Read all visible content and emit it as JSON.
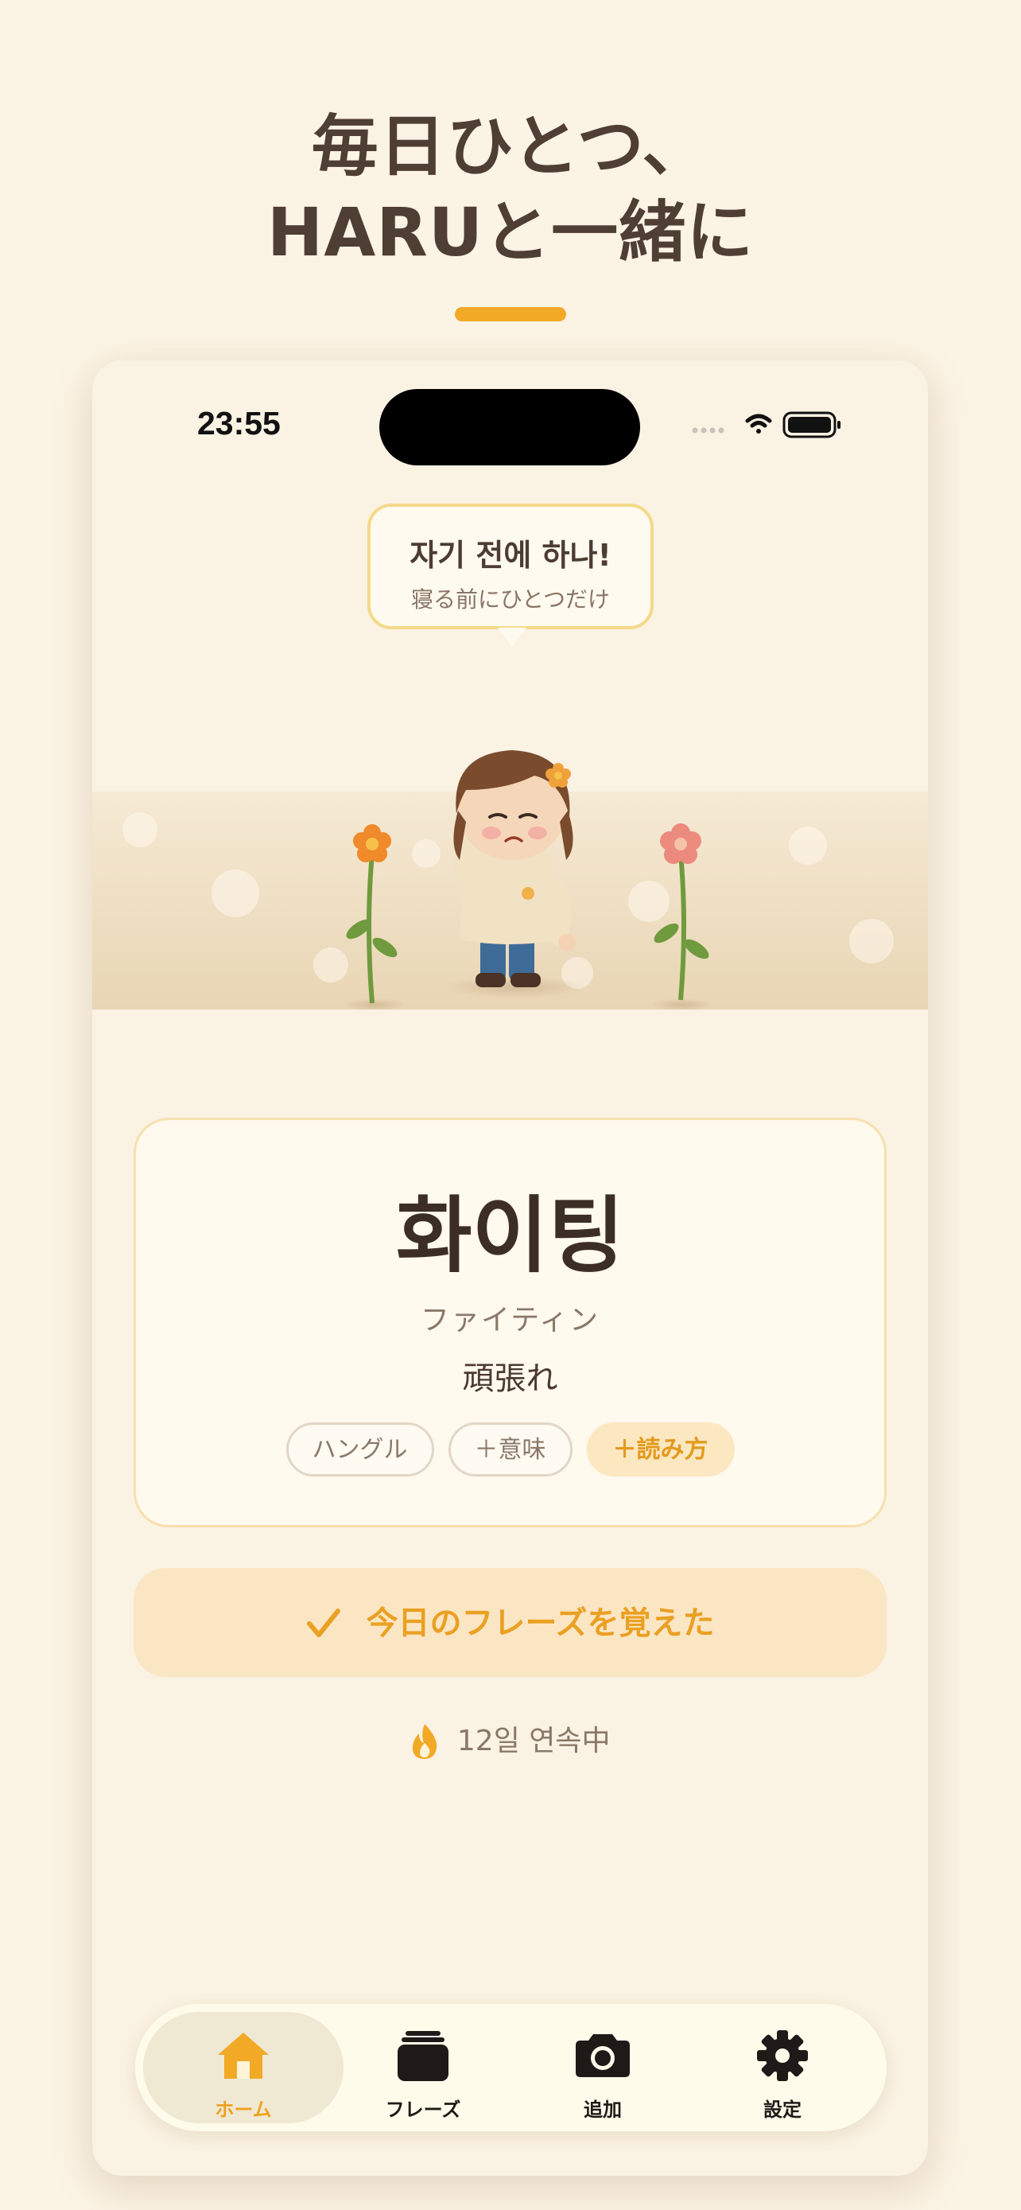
{
  "headline": {
    "line1": "毎日ひとつ、",
    "line2": "HARUと一緒に"
  },
  "status_bar": {
    "time": "23:55"
  },
  "speech_bubble": {
    "korean": "자기 전에 하나!",
    "japanese": "寝る前にひとつだけ"
  },
  "phrase_card": {
    "word": "화이팅",
    "reading": "ファイティン",
    "meaning": "頑張れ",
    "chips": [
      {
        "label": "ハングル",
        "active": false
      },
      {
        "label": "＋意味",
        "active": false
      },
      {
        "label": "＋読み方",
        "active": true
      }
    ]
  },
  "learn_button": {
    "label": "今日のフレーズを覚えた"
  },
  "streak": {
    "text": "12일 연속中"
  },
  "tabbar": {
    "tabs": [
      {
        "label": "ホーム",
        "icon": "home-icon",
        "active": true
      },
      {
        "label": "フレーズ",
        "icon": "cards-stack-icon",
        "active": false
      },
      {
        "label": "追加",
        "icon": "camera-icon",
        "active": false
      },
      {
        "label": "設定",
        "icon": "gear-icon",
        "active": false
      }
    ]
  },
  "colors": {
    "accent": "#f2a926",
    "background": "#fbf3e4",
    "text": "#4f3e33"
  }
}
